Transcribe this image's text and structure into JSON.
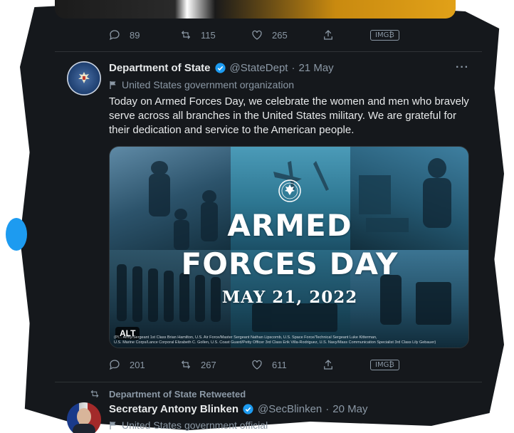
{
  "prev_tweet": {
    "actions": {
      "reply_count": "89",
      "retweet_count": "115",
      "like_count": "265",
      "badge": "IMG₿"
    }
  },
  "tweet": {
    "author_name": "Department of State",
    "handle": "@StateDept",
    "separator": "·",
    "date": "21 May",
    "account_label": "United States government organization",
    "text": "Today on Armed Forces Day, we celebrate the women and men who bravely serve across all branches in the United States military. We are grateful for their dedication and service to the American people.",
    "media": {
      "headline_line1": "ARMED",
      "headline_line2": "FORCES DAY",
      "date_line": "MAY 21, 2022",
      "alt_badge": "ALT",
      "credits_line1": "(Pl...         Army/Sergeant 1st Class Brian Hamilton, U.S. Air Force/Master Sergeant Nathan Lipscomb, U.S. Space Force/Technical Sergeant Luke Kitterman,",
      "credits_line2": "U.S. Marine Corps/Lance Corporal Elizabeth C. Gollen, U.S. Coast Guard/Petty Officer 3rd Class Erik Villa-Rodriguez, U.S. Navy/Mass Communication Specialist 3rd Class Lily Gebauer)"
    },
    "actions": {
      "reply_count": "201",
      "retweet_count": "267",
      "like_count": "611",
      "badge": "IMG₿"
    },
    "more_label": "···"
  },
  "next_tweet": {
    "retweet_context": "Department of State Retweeted",
    "author_name": "Secretary Antony Blinken",
    "handle": "@SecBlinken",
    "separator": "·",
    "date": "20 May",
    "account_label": "United States government official"
  },
  "colors": {
    "background": "#15181c",
    "accent": "#1d9bf0",
    "text": "#e7e9ea",
    "muted": "#8b98a5"
  }
}
